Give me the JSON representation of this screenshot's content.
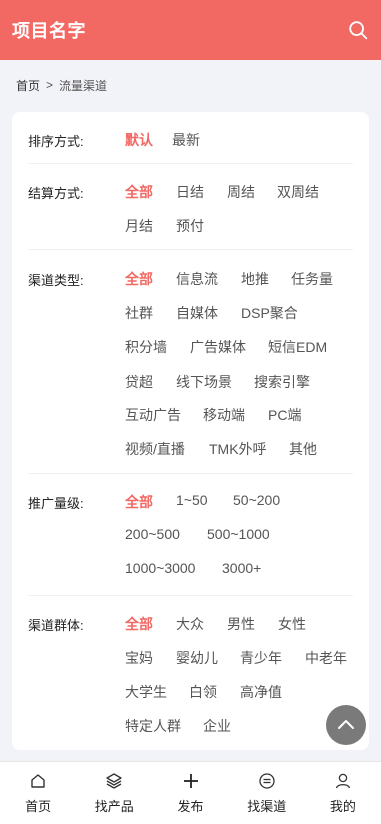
{
  "header": {
    "title": "项目名字",
    "search_icon": "search-icon"
  },
  "breadcrumb": {
    "home": "首页",
    "separator": ">",
    "current": "流量渠道"
  },
  "filters": {
    "sort": {
      "label": "排序方式:",
      "options": [
        "默认",
        "最新"
      ],
      "active": 0
    },
    "settlement": {
      "label": "结算方式:",
      "options": [
        "全部",
        "日结",
        "周结",
        "双周结",
        "月结",
        "预付"
      ],
      "active": 0
    },
    "channel_type": {
      "label": "渠道类型:",
      "options": [
        "全部",
        "信息流",
        "地推",
        "任务量",
        "社群",
        "自媒体",
        "DSP聚合",
        "积分墙",
        "广告媒体",
        "短信EDM",
        "贷超",
        "线下场景",
        "搜索引擎",
        "互动广告",
        "移动端",
        "PC端",
        "视频/直播",
        "TMK外呼",
        "其他"
      ],
      "active": 0
    },
    "volume": {
      "label": "推广量级:",
      "options": [
        "全部",
        "1~50",
        "50~200",
        "200~500",
        "500~1000",
        "1000~3000",
        "3000+"
      ],
      "active": 0
    },
    "audience": {
      "label": "渠道群体:",
      "options": [
        "全部",
        "大众",
        "男性",
        "女性",
        "宝妈",
        "婴幼儿",
        "青少年",
        "中老年",
        "大学生",
        "白领",
        "高净值",
        "特定人群",
        "企业"
      ],
      "active": 0
    }
  },
  "colors": {
    "accent": "#f26964",
    "fab": "#7a7a7a"
  },
  "tabbar": [
    {
      "label": "首页",
      "icon": "home-icon"
    },
    {
      "label": "找产品",
      "icon": "layers-icon"
    },
    {
      "label": "发布",
      "icon": "plus-icon"
    },
    {
      "label": "找渠道",
      "icon": "channel-icon"
    },
    {
      "label": "我的",
      "icon": "user-icon"
    }
  ]
}
